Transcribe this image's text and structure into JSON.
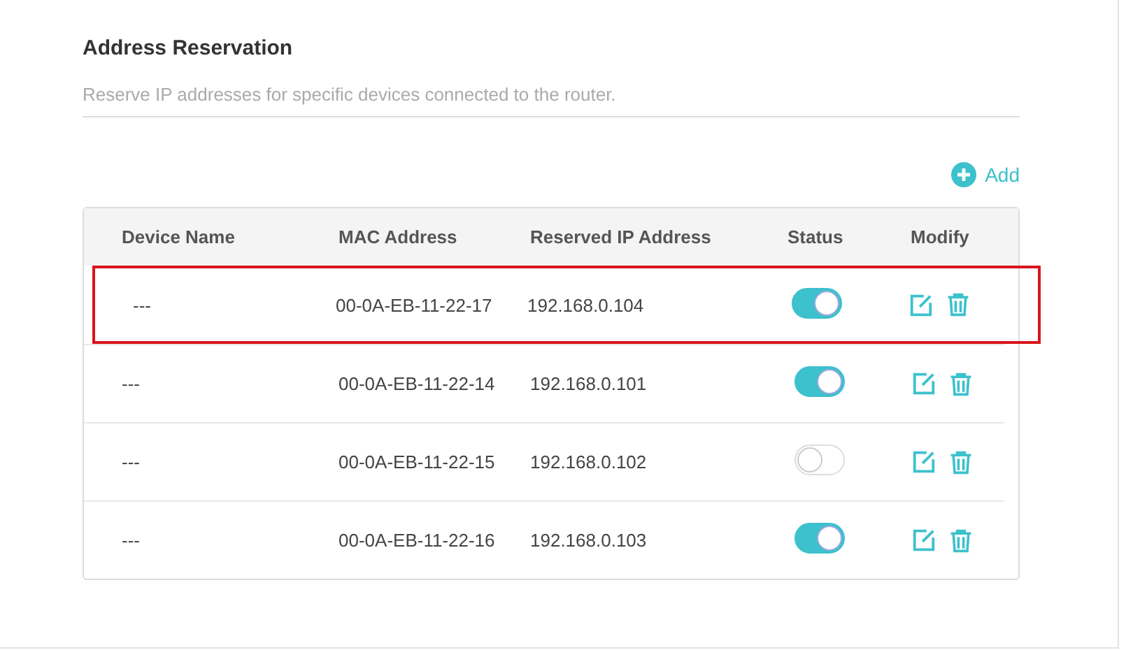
{
  "section": {
    "title": "Address Reservation",
    "description": "Reserve IP addresses for specific devices connected to the router."
  },
  "add_button": {
    "label": "Add"
  },
  "table": {
    "columns": [
      "Device Name",
      "MAC Address",
      "Reserved IP Address",
      "Status",
      "Modify"
    ],
    "rows": [
      {
        "device_name": "---",
        "mac": "00-0A-EB-11-22-17",
        "ip": "192.168.0.104",
        "on": true,
        "highlighted": true
      },
      {
        "device_name": "---",
        "mac": "00-0A-EB-11-22-14",
        "ip": "192.168.0.101",
        "on": true,
        "highlighted": false
      },
      {
        "device_name": "---",
        "mac": "00-0A-EB-11-22-15",
        "ip": "192.168.0.102",
        "on": false,
        "highlighted": false
      },
      {
        "device_name": "---",
        "mac": "00-0A-EB-11-22-16",
        "ip": "192.168.0.103",
        "on": true,
        "highlighted": false
      }
    ]
  }
}
